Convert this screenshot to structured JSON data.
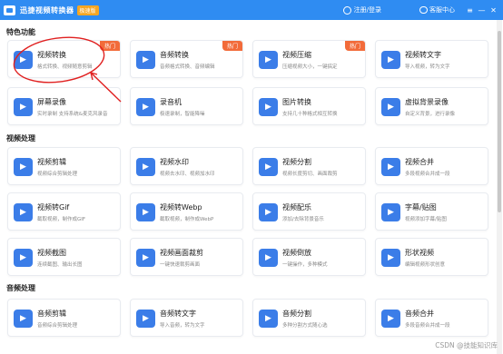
{
  "app": {
    "title": "迅捷视频转换器",
    "badge": "极速版",
    "login": "注册/登录",
    "service": "客服中心"
  },
  "window": {
    "menu": "≡",
    "minimize": "—",
    "close": "✕"
  },
  "sections": {
    "featured": "特色功能",
    "video": "视频处理",
    "audio": "音频处理"
  },
  "featured": [
    {
      "title": "视频转换",
      "desc": "格式转换、视频随意剪辑",
      "hot": "热门",
      "color": "#3b7de8"
    },
    {
      "title": "音频转换",
      "desc": "音频格式转换、音频编辑",
      "hot": "热门",
      "color": "#3b7de8"
    },
    {
      "title": "视频压缩",
      "desc": "压缩视频大小，一键搞定",
      "hot": "热门",
      "color": "#3b7de8"
    },
    {
      "title": "视频转文字",
      "desc": "导入视频，转为文字",
      "hot": "",
      "color": "#3b7de8"
    },
    {
      "title": "屏幕录像",
      "desc": "实时录制 支持系统&麦克风录音",
      "hot": "",
      "color": "#3b7de8"
    },
    {
      "title": "录音机",
      "desc": "极速录制，智能降噪",
      "hot": "",
      "color": "#3b7de8"
    },
    {
      "title": "图片转换",
      "desc": "支持几十种格式相互转换",
      "hot": "",
      "color": "#3b7de8"
    },
    {
      "title": "虚拟背景录像",
      "desc": "自定义背景，进行录像",
      "hot": "",
      "color": "#3b7de8"
    }
  ],
  "video": [
    {
      "title": "视频剪辑",
      "desc": "视频综合剪辑处理"
    },
    {
      "title": "视频水印",
      "desc": "视频去水印、视频加水印"
    },
    {
      "title": "视频分割",
      "desc": "视频长度剪切、画面裁剪"
    },
    {
      "title": "视频合并",
      "desc": "多段视频合并成一段"
    },
    {
      "title": "视频转Gif",
      "desc": "截取视频，制作成GIF"
    },
    {
      "title": "视频转Webp",
      "desc": "截取视频，制作成WebP"
    },
    {
      "title": "视频配乐",
      "desc": "添加/去除背景音乐"
    },
    {
      "title": "字幕/贴图",
      "desc": "视频添加字幕/贴图"
    },
    {
      "title": "视频截图",
      "desc": "连续截图、输出长图"
    },
    {
      "title": "视频画面裁剪",
      "desc": "一键快速裁剪画面"
    },
    {
      "title": "视频倒放",
      "desc": "一键操作，多种模式"
    },
    {
      "title": "形状视频",
      "desc": "编辑视频形状创意"
    }
  ],
  "audio": [
    {
      "title": "音频剪辑",
      "desc": "音频综合剪辑处理"
    },
    {
      "title": "音频转文字",
      "desc": "导入音频，转为文字"
    },
    {
      "title": "音频分割",
      "desc": "多种分割方式随心选"
    },
    {
      "title": "音频合并",
      "desc": "多段音频合并成一段"
    }
  ],
  "watermark": "CSDN @技能知识库"
}
